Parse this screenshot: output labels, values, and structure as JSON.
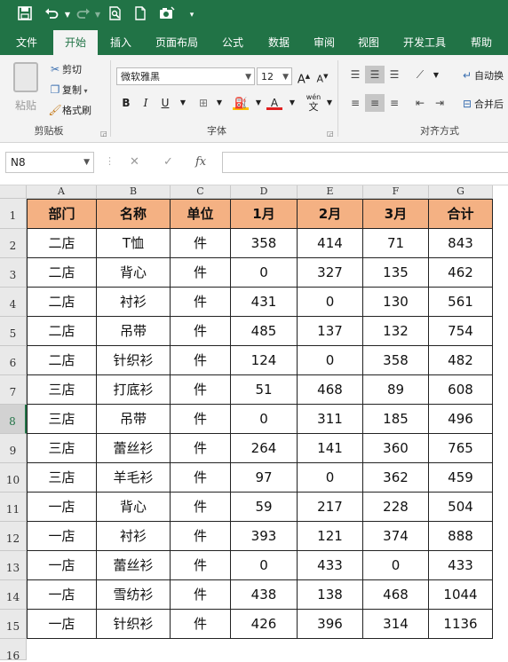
{
  "colors": {
    "brand": "#217346",
    "header_fill": "#f4b183"
  },
  "quick_access": {
    "icons": [
      "save-icon",
      "undo-icon",
      "redo-icon",
      "print-preview-icon",
      "new-file-icon",
      "camera-icon",
      "customize-qat-icon"
    ]
  },
  "ribbon_tabs": [
    "文件",
    "开始",
    "插入",
    "页面布局",
    "公式",
    "数据",
    "审阅",
    "视图",
    "开发工具",
    "帮助"
  ],
  "active_tab": "开始",
  "clipboard": {
    "paste": "粘贴",
    "cut": "剪切",
    "copy": "复制",
    "format_painter": "格式刷",
    "group_label": "剪贴板"
  },
  "font": {
    "name": "微软雅黑",
    "size": "12",
    "group_label": "字体",
    "bold": "B",
    "italic": "I",
    "underline": "U",
    "increase": "A",
    "decrease": "A",
    "color_letter": "A",
    "phonetic": "wén"
  },
  "alignment": {
    "group_label": "对齐方式",
    "wrap_text": "自动换",
    "merge_center": "合并后"
  },
  "formula_bar": {
    "name_box": "N8",
    "formula": ""
  },
  "columns": [
    "A",
    "B",
    "C",
    "D",
    "E",
    "F",
    "G"
  ],
  "rows": [
    "1",
    "2",
    "3",
    "4",
    "5",
    "6",
    "7",
    "8",
    "9",
    "10",
    "11",
    "12",
    "13",
    "14",
    "15",
    "16"
  ],
  "selected_row": "8",
  "table": {
    "headers": [
      "部门",
      "名称",
      "单位",
      "1月",
      "2月",
      "3月",
      "合计"
    ],
    "data": [
      [
        "二店",
        "T恤",
        "件",
        "358",
        "414",
        "71",
        "843"
      ],
      [
        "二店",
        "背心",
        "件",
        "0",
        "327",
        "135",
        "462"
      ],
      [
        "二店",
        "衬衫",
        "件",
        "431",
        "0",
        "130",
        "561"
      ],
      [
        "二店",
        "吊带",
        "件",
        "485",
        "137",
        "132",
        "754"
      ],
      [
        "二店",
        "针织衫",
        "件",
        "124",
        "0",
        "358",
        "482"
      ],
      [
        "三店",
        "打底衫",
        "件",
        "51",
        "468",
        "89",
        "608"
      ],
      [
        "三店",
        "吊带",
        "件",
        "0",
        "311",
        "185",
        "496"
      ],
      [
        "三店",
        "蕾丝衫",
        "件",
        "264",
        "141",
        "360",
        "765"
      ],
      [
        "三店",
        "羊毛衫",
        "件",
        "97",
        "0",
        "362",
        "459"
      ],
      [
        "一店",
        "背心",
        "件",
        "59",
        "217",
        "228",
        "504"
      ],
      [
        "一店",
        "衬衫",
        "件",
        "393",
        "121",
        "374",
        "888"
      ],
      [
        "一店",
        "蕾丝衫",
        "件",
        "0",
        "433",
        "0",
        "433"
      ],
      [
        "一店",
        "雪纺衫",
        "件",
        "438",
        "138",
        "468",
        "1044"
      ],
      [
        "一店",
        "针织衫",
        "件",
        "426",
        "396",
        "314",
        "1136"
      ]
    ]
  }
}
